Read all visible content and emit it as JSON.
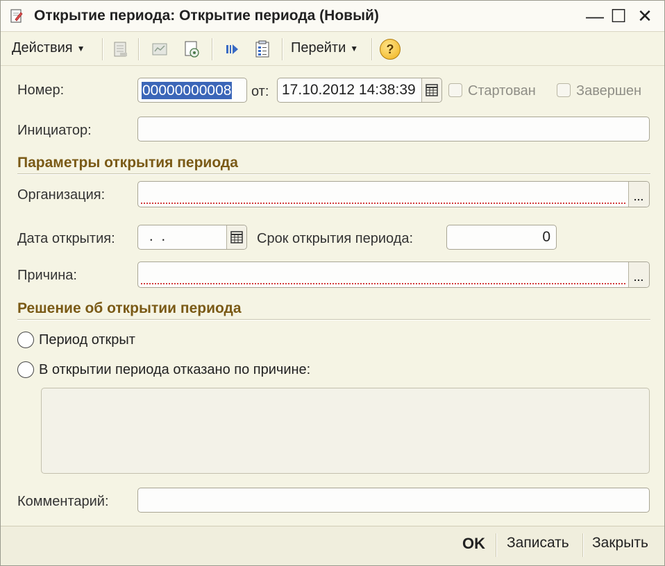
{
  "window": {
    "title": "Открытие периода: Открытие периода (Новый)",
    "controls": {
      "minimize": "—",
      "maximize": "☐",
      "close": "✕"
    }
  },
  "toolbar": {
    "actions_label": "Действия",
    "goto_label": "Перейти",
    "help_label": "?",
    "icons": [
      "post-document-icon",
      "movements-icon",
      "copy-document-icon",
      "next-step-icon",
      "structure-icon"
    ]
  },
  "form": {
    "number_label": "Номер:",
    "number_value": "00000000008",
    "from_label": "от:",
    "date_value": "17.10.2012 14:38:39",
    "started_label": "Стартован",
    "completed_label": "Завершен",
    "initiator_label": "Инициатор:",
    "initiator_value": "",
    "params_section": "Параметры открытия периода",
    "organization_label": "Организация:",
    "organization_value": "",
    "open_date_label": "Дата открытия:",
    "open_date_value": " .  .",
    "term_label": "Срок открытия периода:",
    "term_value": "0",
    "reason_label": "Причина:",
    "reason_value": "",
    "decision_section": "Решение об открытии периода",
    "radio_open_label": "Период открыт",
    "radio_refused_label": "В открытии периода отказано по причине:",
    "refuse_reason_value": "",
    "comment_label": "Комментарий:",
    "comment_value": ""
  },
  "buttons": {
    "ok": "OK",
    "save": "Записать",
    "close": "Закрыть"
  },
  "colors": {
    "section": "#7a5a16",
    "background": "#f5f4e4",
    "selection": "#3b66b8"
  }
}
